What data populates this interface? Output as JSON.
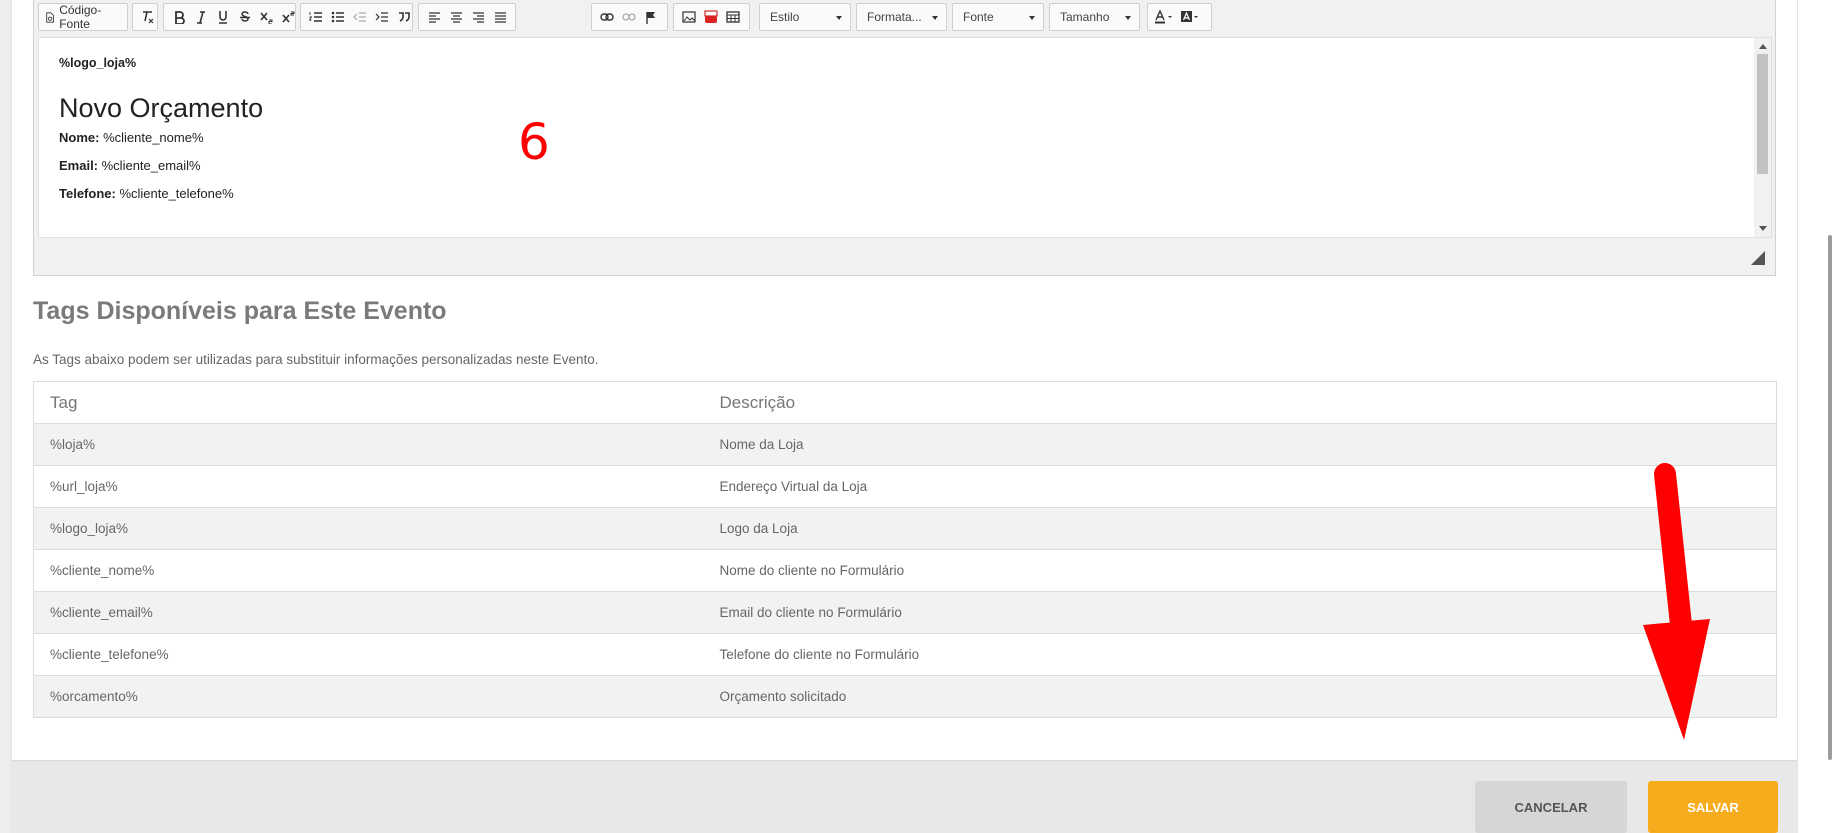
{
  "toolbar": {
    "source_label": "Código-Fonte",
    "style_combo": "Estilo",
    "format_combo": "Formata...",
    "font_combo": "Fonte",
    "size_combo": "Tamanho"
  },
  "editor": {
    "logo_tag": "%logo_loja%",
    "heading": "Novo Orçamento",
    "fields": [
      {
        "label": "Nome:",
        "value": " %cliente_nome%"
      },
      {
        "label": "Email:",
        "value": " %cliente_email%"
      },
      {
        "label": "Telefone:",
        "value": " %cliente_telefone%"
      }
    ]
  },
  "annotation": {
    "step_number": "6",
    "arrow_color": "#ff0000"
  },
  "tags_section": {
    "title": "Tags Disponíveis para Este Evento",
    "description": "As Tags abaixo podem ser utilizadas para substituir informações personalizadas neste Evento.",
    "columns": [
      "Tag",
      "Descrição"
    ],
    "rows": [
      [
        "%loja%",
        "Nome da Loja"
      ],
      [
        "%url_loja%",
        "Endereço Virtual da Loja"
      ],
      [
        "%logo_loja%",
        "Logo da Loja"
      ],
      [
        "%cliente_nome%",
        "Nome do cliente no Formulário"
      ],
      [
        "%cliente_email%",
        "Email do cliente no Formulário"
      ],
      [
        "%cliente_telefone%",
        "Telefone do cliente no Formulário"
      ],
      [
        "%orcamento%",
        "Orçamento solicitado"
      ]
    ]
  },
  "footer": {
    "cancel_label": "CANCELAR",
    "save_label": "SALVAR"
  },
  "colors": {
    "accent": "#f7ac1d",
    "cancel_bg": "#d6d6d6",
    "annotation": "#ff0000"
  }
}
